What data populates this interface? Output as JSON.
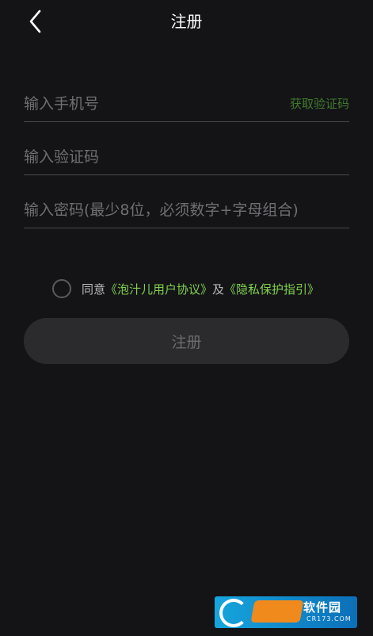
{
  "header": {
    "title": "注册"
  },
  "form": {
    "phone": {
      "placeholder": "输入手机号",
      "value": ""
    },
    "get_code_label": "获取验证码",
    "code": {
      "placeholder": "输入验证码",
      "value": ""
    },
    "password": {
      "placeholder": "输入密码(最少8位，必须数字+字母组合)",
      "value": ""
    }
  },
  "agreement": {
    "prefix": "同意",
    "link1": "《泡汁儿用户协议》",
    "joiner": "及",
    "link2": "《隐私保护指引》",
    "checked": false
  },
  "submit": {
    "label": "注册"
  },
  "watermark": {
    "name": "软件园",
    "domain": "CR173.COM"
  },
  "colors": {
    "background": "#141417",
    "accent_link": "#7fd14d",
    "get_code": "#3f7a2c",
    "button_bg": "#2b2b2e",
    "divider": "#4a4a4f"
  }
}
